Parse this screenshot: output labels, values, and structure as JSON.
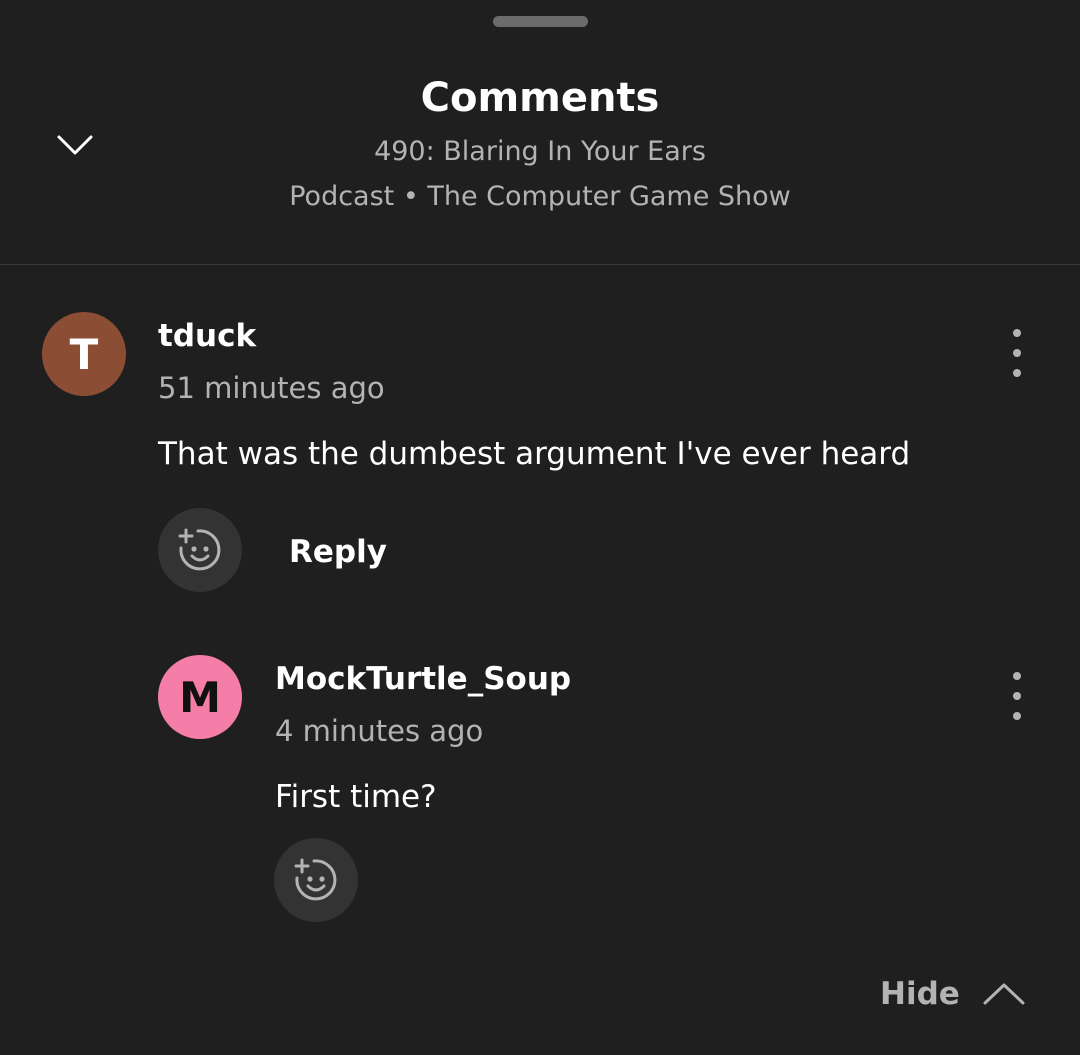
{
  "header": {
    "title": "Comments",
    "episode": "490: Blaring In Your Ears",
    "subline": "Podcast • The Computer Game Show"
  },
  "comments": [
    {
      "avatar_letter": "T",
      "avatar_color": "#8b4e35",
      "username": "tduck",
      "timestamp": "51 minutes ago",
      "text": "That was the dumbest argument I've ever heard",
      "reply_label": "Reply"
    },
    {
      "avatar_letter": "M",
      "avatar_color": "#f47ea7",
      "username": "MockTurtle_Soup",
      "timestamp": "4 minutes ago",
      "text": "First time?"
    }
  ],
  "footer": {
    "hide_label": "Hide"
  },
  "icons": {
    "collapse": "chevron-down-icon",
    "more": "more-vertical-icon",
    "react": "add-emoji-icon",
    "hide": "chevron-up-icon"
  },
  "colors": {
    "background": "#1f1f1f",
    "secondary_text": "#b3b3b3",
    "react_button_bg": "#333333"
  }
}
